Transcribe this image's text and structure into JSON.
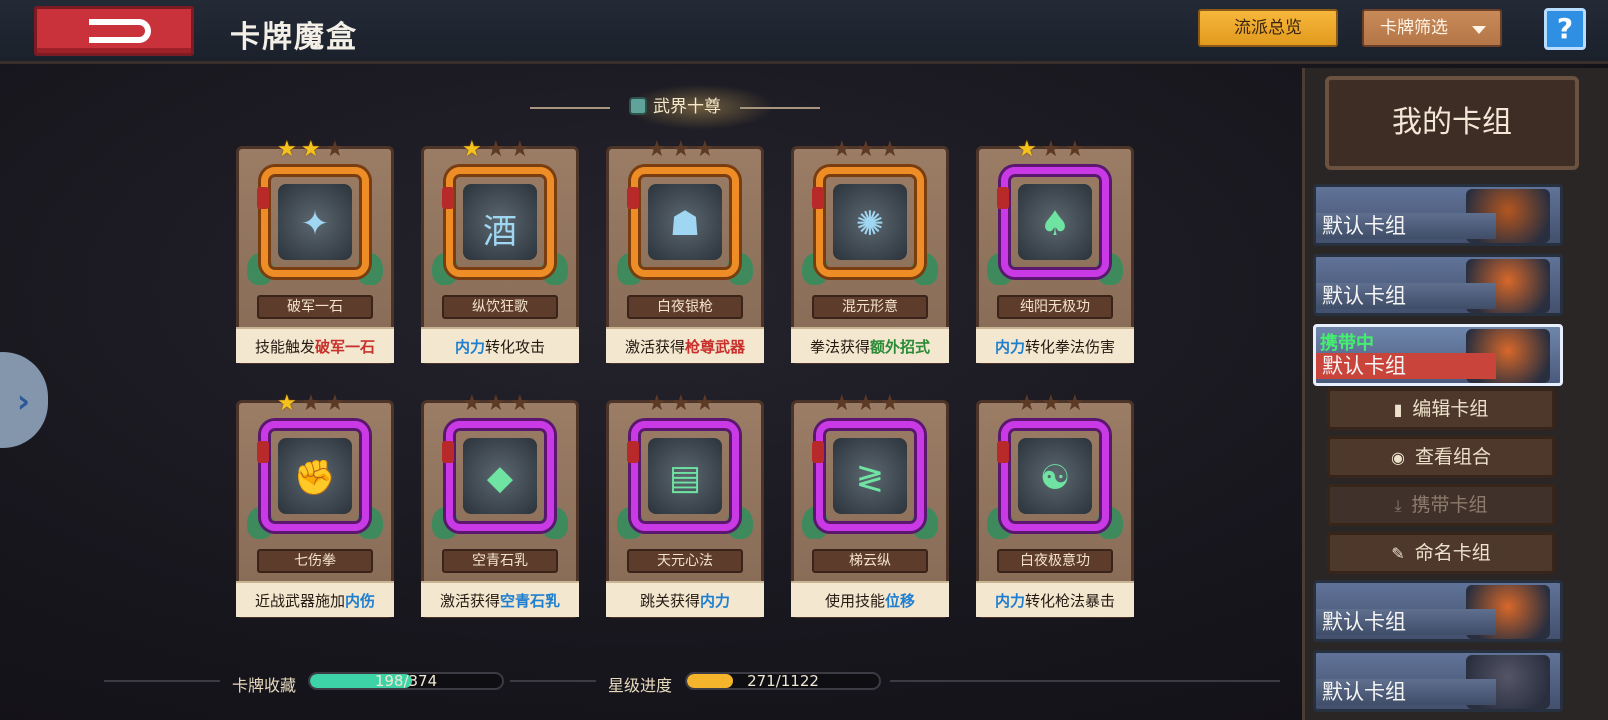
{
  "header": {
    "title": "卡牌魔盒",
    "overview_button": "流派总览",
    "filter_button": "卡牌筛选",
    "help_button": "?"
  },
  "section": {
    "title": "武界十尊"
  },
  "cards": [
    {
      "name": "破军一石",
      "desc_pre": "技能触发",
      "desc_hl": "破军一石",
      "desc_post": "",
      "hl": "hl-red",
      "stars": 2,
      "rarity": "orange",
      "glyph": "✦"
    },
    {
      "name": "纵饮狂歌",
      "desc_pre": "",
      "desc_hl": "内力",
      "desc_post": "转化攻击",
      "hl": "hl-blue",
      "stars": 1,
      "rarity": "orange",
      "glyph": "酒"
    },
    {
      "name": "白夜银枪",
      "desc_pre": "激活获得",
      "desc_hl": "枪尊武器",
      "desc_post": "",
      "hl": "hl-red",
      "stars": 0,
      "rarity": "orange",
      "glyph": "☗"
    },
    {
      "name": "混元形意",
      "desc_pre": "拳法获得",
      "desc_hl": "额外招式",
      "desc_post": "",
      "hl": "hl-green",
      "stars": 0,
      "rarity": "orange",
      "glyph": "✺"
    },
    {
      "name": "纯阳无极功",
      "desc_pre": "",
      "desc_hl": "内力",
      "desc_post": "转化拳法伤害",
      "hl": "hl-blue",
      "stars": 1,
      "rarity": "purple",
      "glyph": "♠"
    },
    {
      "name": "七伤拳",
      "desc_pre": "近战武器施加",
      "desc_hl": "内伤",
      "desc_post": "",
      "hl": "hl-blue",
      "stars": 1,
      "rarity": "purple",
      "glyph": "✊"
    },
    {
      "name": "空青石乳",
      "desc_pre": "激活获得",
      "desc_hl": "空青石乳",
      "desc_post": "",
      "hl": "hl-blue",
      "stars": 0,
      "rarity": "purple",
      "glyph": "◆"
    },
    {
      "name": "天元心法",
      "desc_pre": "跳关获得",
      "desc_hl": "内力",
      "desc_post": "",
      "hl": "hl-blue",
      "stars": 0,
      "rarity": "purple",
      "glyph": "▤"
    },
    {
      "name": "梯云纵",
      "desc_pre": "使用技能",
      "desc_hl": "位移",
      "desc_post": "",
      "hl": "hl-blue",
      "stars": 0,
      "rarity": "purple",
      "glyph": "≷"
    },
    {
      "name": "白夜极意功",
      "desc_pre": "",
      "desc_hl": "内力",
      "desc_post": "转化枪法暴击",
      "hl": "hl-blue",
      "stars": 0,
      "rarity": "purple",
      "glyph": "☯"
    }
  ],
  "footer": {
    "collection_label": "卡牌收藏",
    "collection_value": "198/374",
    "collection_fraction": 0.529,
    "star_label": "星级进度",
    "star_value": "271/1122",
    "star_fraction": 0.242
  },
  "sidebar": {
    "title": "我的卡组",
    "decks": [
      {
        "label": "默认卡组",
        "active": false,
        "portrait": "#b4561f"
      },
      {
        "label": "默认卡组",
        "active": false,
        "portrait": "#d7682a"
      },
      {
        "label": "默认卡组",
        "active": true,
        "carrying": "携带中",
        "portrait": "#d7682a"
      }
    ],
    "actions": [
      {
        "label": "编辑卡组",
        "icon": "▮",
        "disabled": false
      },
      {
        "label": "查看组合",
        "icon": "◉",
        "disabled": false
      },
      {
        "label": "携带卡组",
        "icon": "⤓",
        "disabled": true
      },
      {
        "label": "命名卡组",
        "icon": "✎",
        "disabled": false
      }
    ],
    "decks_after": [
      {
        "label": "默认卡组",
        "portrait": "#d7682a"
      },
      {
        "label": "默认卡组",
        "portrait": "#556"
      }
    ]
  },
  "colors": {
    "accent_orange": "#f7b73b",
    "rarity_orange": "#ee8d25",
    "rarity_purple": "#c93ae6",
    "collection_bar": "#3ed3a6",
    "star_bar": "#f4b42c"
  }
}
